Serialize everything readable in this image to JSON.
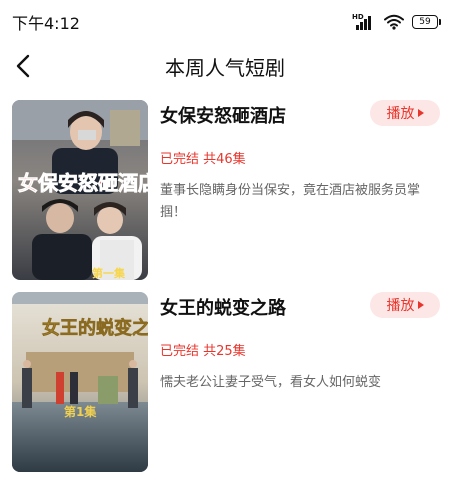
{
  "status_bar": {
    "time": "下午4:12",
    "signal_label": "HD",
    "battery": "59"
  },
  "header": {
    "title": "本周人气短剧"
  },
  "dramas": [
    {
      "title": "女保安怒砸酒店",
      "status": "已完结 共46集",
      "description": "董事长隐瞒身份当保安，竟在酒店被服务员掌掴！",
      "play_label": "播放",
      "poster_title": "女保安怒砸酒店",
      "poster_badge": "第一集"
    },
    {
      "title": "女王的蜕变之路",
      "status": "已完结 共25集",
      "description": "懦夫老公让妻子受气，看女人如何蜕变",
      "play_label": "播放",
      "poster_title": "女王的蜕变之路",
      "poster_badge": "第1集"
    }
  ],
  "colors": {
    "accent": "#e8362d",
    "accent_bg": "#fde7e6"
  }
}
